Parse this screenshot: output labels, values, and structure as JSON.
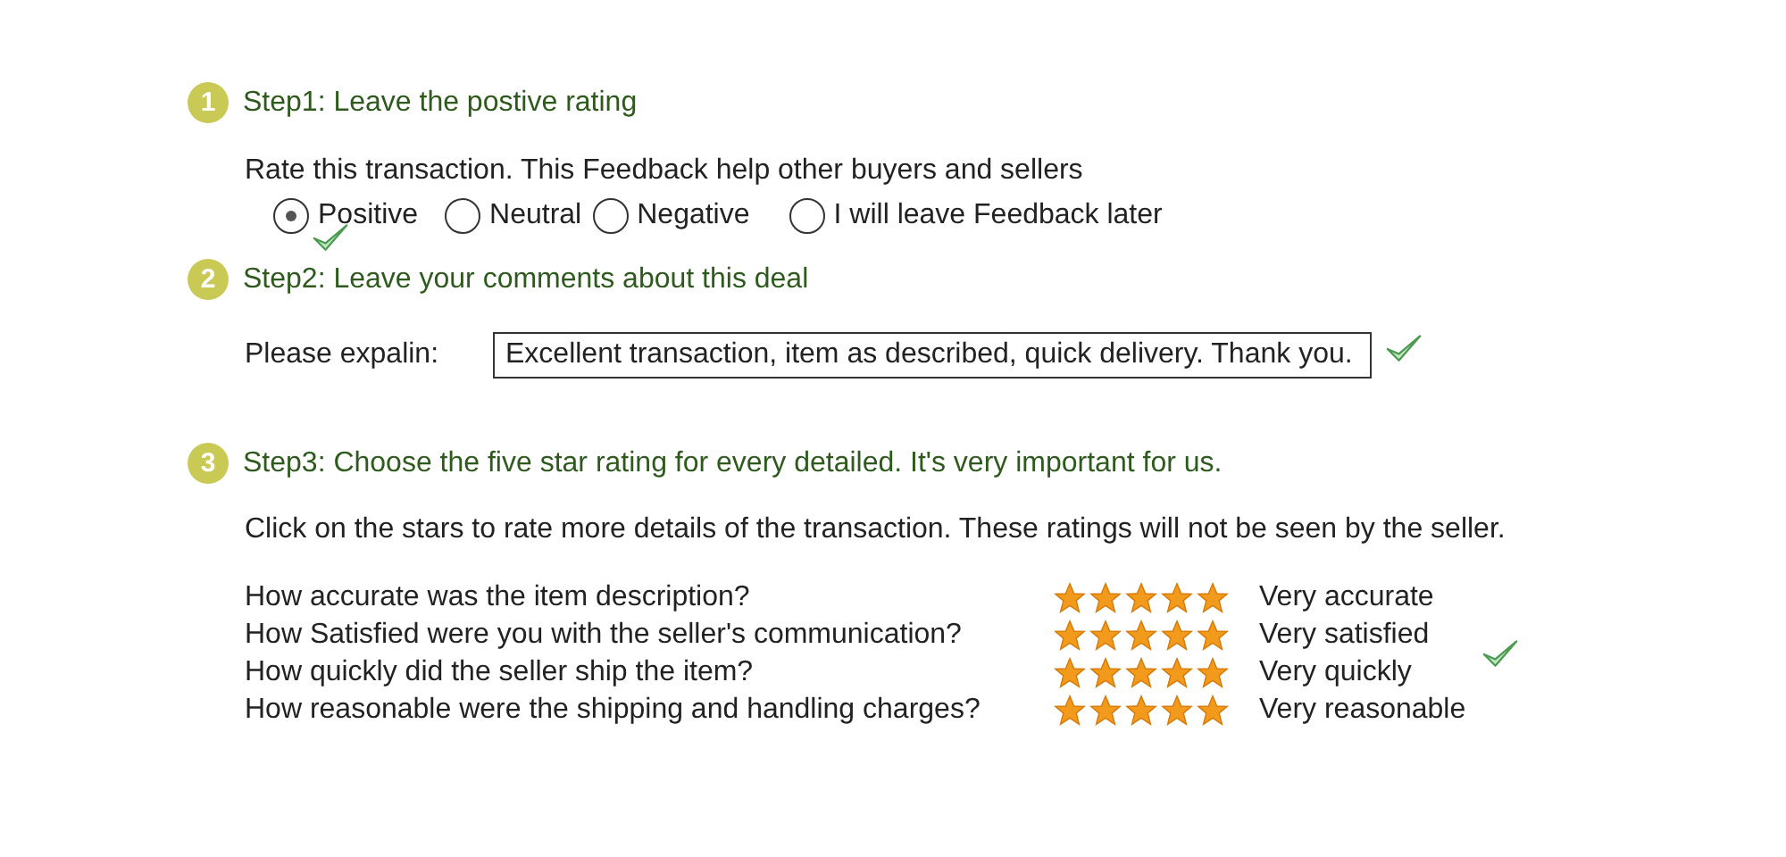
{
  "step1": {
    "number": "1",
    "title": "Step1: Leave the postive rating",
    "prompt": "Rate this transaction. This Feedback help other buyers and sellers",
    "options": [
      {
        "label": "Positive",
        "selected": true
      },
      {
        "label": "Neutral",
        "selected": false
      },
      {
        "label": "Negative",
        "selected": false
      },
      {
        "label": "I will leave Feedback later",
        "selected": false
      }
    ]
  },
  "step2": {
    "number": "2",
    "title": "Step2: Leave your comments about this deal",
    "label": "Please expalin:",
    "value": "Excellent transaction, item as described, quick delivery. Thank you."
  },
  "step3": {
    "number": "3",
    "title": "Step3: Choose the five star rating for every detailed. It's very important for us.",
    "intro": "Click on the stars to rate more details of the transaction. These ratings will not be seen by the seller.",
    "rows": [
      {
        "question": "How accurate was the item description?",
        "stars": 5,
        "answer": "Very accurate"
      },
      {
        "question": "How Satisfied were you with the seller's communication?",
        "stars": 5,
        "answer": "Very satisfied"
      },
      {
        "question": "How quickly did the seller ship the item?",
        "stars": 5,
        "answer": "Very quickly"
      },
      {
        "question": "How reasonable were the shipping and handling charges?",
        "stars": 5,
        "answer": "Very reasonable"
      }
    ]
  }
}
